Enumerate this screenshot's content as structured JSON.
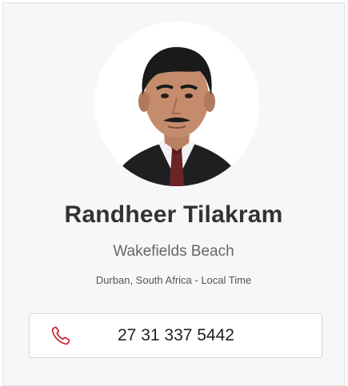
{
  "profile": {
    "name": "Randheer Tilakram",
    "location": "Wakefields Beach",
    "local_time": "Durban, South Africa - Local Time"
  },
  "contact": {
    "phone_number": "27 31 337 5442",
    "phone_icon": "phone-icon"
  },
  "colors": {
    "accent": "#c8272e",
    "card_background": "#f7f7f7",
    "name_text": "#333333"
  }
}
